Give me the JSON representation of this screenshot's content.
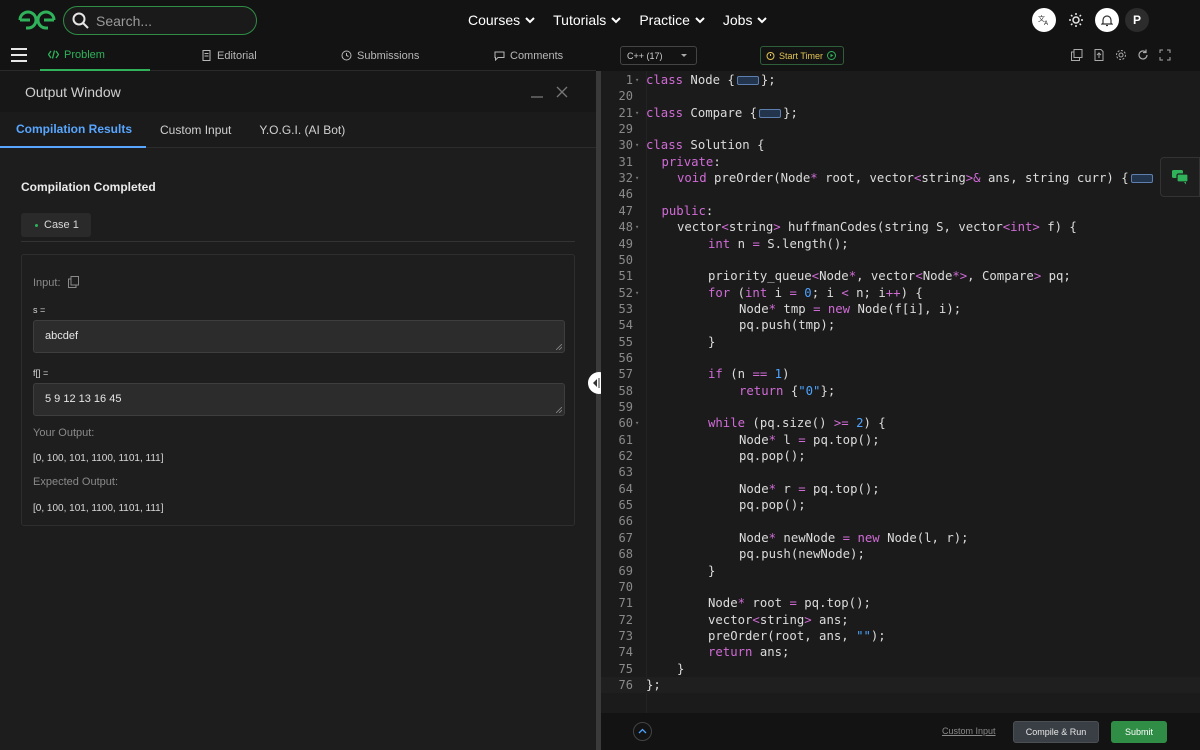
{
  "search": {
    "placeholder": "Search..."
  },
  "nav": {
    "links": [
      "Courses",
      "Tutorials",
      "Practice",
      "Jobs"
    ],
    "avatar_letter": "P"
  },
  "problem_tabs": {
    "problem": "Problem",
    "editorial": "Editorial",
    "submissions": "Submissions",
    "comments": "Comments"
  },
  "output": {
    "title": "Output Window",
    "tabs": {
      "compilation": "Compilation Results",
      "custom": "Custom Input",
      "yogi": "Y.O.G.I. (AI Bot)"
    },
    "status": "Compilation Completed",
    "case_label": "Case 1",
    "input_label": "Input:",
    "s_label": "s =",
    "s_value": "abcdef",
    "f_label": "f[] =",
    "f_value": "5 9 12 13 16 45",
    "your_output_label": "Your Output:",
    "your_output": "[0, 100, 101, 1100, 1101, 111]",
    "expected_label": "Expected Output:",
    "expected_output": "[0, 100, 101, 1100, 1101, 111]"
  },
  "editor": {
    "language": "C++ (17)",
    "timer_label": "Start Timer",
    "lines": [
      {
        "n": "1",
        "fold": true,
        "ind": 0,
        "toks": [
          [
            "kw",
            "class"
          ],
          [
            "t",
            " Node {"
          ],
          [
            "badge",
            ""
          ],
          [
            "t",
            "};"
          ]
        ]
      },
      {
        "n": "20",
        "fold": false,
        "ind": 0,
        "toks": []
      },
      {
        "n": "21",
        "fold": true,
        "ind": 0,
        "toks": [
          [
            "kw",
            "class"
          ],
          [
            "t",
            " Compare {"
          ],
          [
            "badge",
            ""
          ],
          [
            "t",
            "};"
          ]
        ]
      },
      {
        "n": "29",
        "fold": false,
        "ind": 0,
        "toks": []
      },
      {
        "n": "30",
        "fold": true,
        "ind": 0,
        "toks": [
          [
            "kw",
            "class"
          ],
          [
            "t",
            " Solution {"
          ]
        ]
      },
      {
        "n": "31",
        "fold": false,
        "ind": 2,
        "toks": [
          [
            "kw",
            "private"
          ],
          [
            "t",
            ":"
          ]
        ]
      },
      {
        "n": "32",
        "fold": true,
        "ind": 4,
        "toks": [
          [
            "kw",
            "void"
          ],
          [
            "t",
            " preOrder(Node"
          ],
          [
            "kw",
            "*"
          ],
          [
            "t",
            " root, vector"
          ],
          [
            "kw",
            "<"
          ],
          [
            "t",
            "string"
          ],
          [
            "kw",
            ">&"
          ],
          [
            "t",
            " ans, string curr) {"
          ],
          [
            "badge",
            ""
          ]
        ]
      },
      {
        "n": "46",
        "fold": false,
        "ind": 0,
        "toks": []
      },
      {
        "n": "47",
        "fold": false,
        "ind": 2,
        "toks": [
          [
            "kw",
            "public"
          ],
          [
            "t",
            ":"
          ]
        ]
      },
      {
        "n": "48",
        "fold": true,
        "ind": 4,
        "toks": [
          [
            "t",
            "vector"
          ],
          [
            "kw",
            "<"
          ],
          [
            "t",
            "string"
          ],
          [
            "kw",
            ">"
          ],
          [
            "t",
            " huffmanCodes(string S, vector"
          ],
          [
            "kw",
            "<int>"
          ],
          [
            "t",
            " f) {"
          ]
        ]
      },
      {
        "n": "49",
        "fold": false,
        "ind": 8,
        "toks": [
          [
            "kw",
            "int"
          ],
          [
            "t",
            " n "
          ],
          [
            "kw",
            "="
          ],
          [
            "t",
            " S.length();"
          ]
        ]
      },
      {
        "n": "50",
        "fold": false,
        "ind": 0,
        "toks": []
      },
      {
        "n": "51",
        "fold": false,
        "ind": 8,
        "toks": [
          [
            "t",
            "priority_queue"
          ],
          [
            "kw",
            "<"
          ],
          [
            "t",
            "Node"
          ],
          [
            "kw",
            "*"
          ],
          [
            "t",
            ", vector"
          ],
          [
            "kw",
            "<"
          ],
          [
            "t",
            "Node"
          ],
          [
            "kw",
            "*>"
          ],
          [
            "t",
            ", Compare"
          ],
          [
            "kw",
            ">"
          ],
          [
            "t",
            " pq;"
          ]
        ]
      },
      {
        "n": "52",
        "fold": true,
        "ind": 8,
        "toks": [
          [
            "kw",
            "for"
          ],
          [
            "t",
            " ("
          ],
          [
            "kw",
            "int"
          ],
          [
            "t",
            " i "
          ],
          [
            "kw",
            "="
          ],
          [
            "t",
            " "
          ],
          [
            "num",
            "0"
          ],
          [
            "t",
            "; i "
          ],
          [
            "kw",
            "<"
          ],
          [
            "t",
            " n; i"
          ],
          [
            "kw",
            "++"
          ],
          [
            "t",
            ") {"
          ]
        ]
      },
      {
        "n": "53",
        "fold": false,
        "ind": 12,
        "toks": [
          [
            "t",
            "Node"
          ],
          [
            "kw",
            "*"
          ],
          [
            "t",
            " tmp "
          ],
          [
            "kw",
            "="
          ],
          [
            "t",
            " "
          ],
          [
            "kw",
            "new"
          ],
          [
            "t",
            " Node(f[i], i);"
          ]
        ]
      },
      {
        "n": "54",
        "fold": false,
        "ind": 12,
        "toks": [
          [
            "t",
            "pq.push(tmp);"
          ]
        ]
      },
      {
        "n": "55",
        "fold": false,
        "ind": 8,
        "toks": [
          [
            "t",
            "}"
          ]
        ]
      },
      {
        "n": "56",
        "fold": false,
        "ind": 0,
        "toks": []
      },
      {
        "n": "57",
        "fold": false,
        "ind": 8,
        "toks": [
          [
            "kw",
            "if"
          ],
          [
            "t",
            " (n "
          ],
          [
            "kw",
            "=="
          ],
          [
            "t",
            " "
          ],
          [
            "num",
            "1"
          ],
          [
            "t",
            ")"
          ]
        ]
      },
      {
        "n": "58",
        "fold": false,
        "ind": 12,
        "toks": [
          [
            "kw",
            "return"
          ],
          [
            "t",
            " {"
          ],
          [
            "str",
            "\"0\""
          ],
          [
            "t",
            "};"
          ]
        ]
      },
      {
        "n": "59",
        "fold": false,
        "ind": 0,
        "toks": []
      },
      {
        "n": "60",
        "fold": true,
        "ind": 8,
        "toks": [
          [
            "kw",
            "while"
          ],
          [
            "t",
            " (pq.size() "
          ],
          [
            "kw",
            ">="
          ],
          [
            "t",
            " "
          ],
          [
            "num",
            "2"
          ],
          [
            "t",
            ") {"
          ]
        ]
      },
      {
        "n": "61",
        "fold": false,
        "ind": 12,
        "toks": [
          [
            "t",
            "Node"
          ],
          [
            "kw",
            "*"
          ],
          [
            "t",
            " l "
          ],
          [
            "kw",
            "="
          ],
          [
            "t",
            " pq.top();"
          ]
        ]
      },
      {
        "n": "62",
        "fold": false,
        "ind": 12,
        "toks": [
          [
            "t",
            "pq.pop();"
          ]
        ]
      },
      {
        "n": "63",
        "fold": false,
        "ind": 0,
        "toks": []
      },
      {
        "n": "64",
        "fold": false,
        "ind": 12,
        "toks": [
          [
            "t",
            "Node"
          ],
          [
            "kw",
            "*"
          ],
          [
            "t",
            " r "
          ],
          [
            "kw",
            "="
          ],
          [
            "t",
            " pq.top();"
          ]
        ]
      },
      {
        "n": "65",
        "fold": false,
        "ind": 12,
        "toks": [
          [
            "t",
            "pq.pop();"
          ]
        ]
      },
      {
        "n": "66",
        "fold": false,
        "ind": 0,
        "toks": []
      },
      {
        "n": "67",
        "fold": false,
        "ind": 12,
        "toks": [
          [
            "t",
            "Node"
          ],
          [
            "kw",
            "*"
          ],
          [
            "t",
            " newNode "
          ],
          [
            "kw",
            "="
          ],
          [
            "t",
            " "
          ],
          [
            "kw",
            "new"
          ],
          [
            "t",
            " Node(l, r);"
          ]
        ]
      },
      {
        "n": "68",
        "fold": false,
        "ind": 12,
        "toks": [
          [
            "t",
            "pq.push(newNode);"
          ]
        ]
      },
      {
        "n": "69",
        "fold": false,
        "ind": 8,
        "toks": [
          [
            "t",
            "}"
          ]
        ]
      },
      {
        "n": "70",
        "fold": false,
        "ind": 0,
        "toks": []
      },
      {
        "n": "71",
        "fold": false,
        "ind": 8,
        "toks": [
          [
            "t",
            "Node"
          ],
          [
            "kw",
            "*"
          ],
          [
            "t",
            " root "
          ],
          [
            "kw",
            "="
          ],
          [
            "t",
            " pq.top();"
          ]
        ]
      },
      {
        "n": "72",
        "fold": false,
        "ind": 8,
        "toks": [
          [
            "t",
            "vector"
          ],
          [
            "kw",
            "<"
          ],
          [
            "t",
            "string"
          ],
          [
            "kw",
            ">"
          ],
          [
            "t",
            " ans;"
          ]
        ]
      },
      {
        "n": "73",
        "fold": false,
        "ind": 8,
        "toks": [
          [
            "t",
            "preOrder(root, ans, "
          ],
          [
            "str",
            "\"\""
          ],
          [
            "t",
            ");"
          ]
        ]
      },
      {
        "n": "74",
        "fold": false,
        "ind": 8,
        "toks": [
          [
            "kw",
            "return"
          ],
          [
            "t",
            " ans;"
          ]
        ]
      },
      {
        "n": "75",
        "fold": false,
        "ind": 4,
        "toks": [
          [
            "t",
            "}"
          ]
        ]
      },
      {
        "n": "76",
        "fold": false,
        "ind": 0,
        "toks": [
          [
            "t",
            "};"
          ]
        ]
      }
    ]
  },
  "footer": {
    "custom_input": "Custom Input",
    "compile_run": "Compile & Run",
    "submit": "Submit"
  }
}
